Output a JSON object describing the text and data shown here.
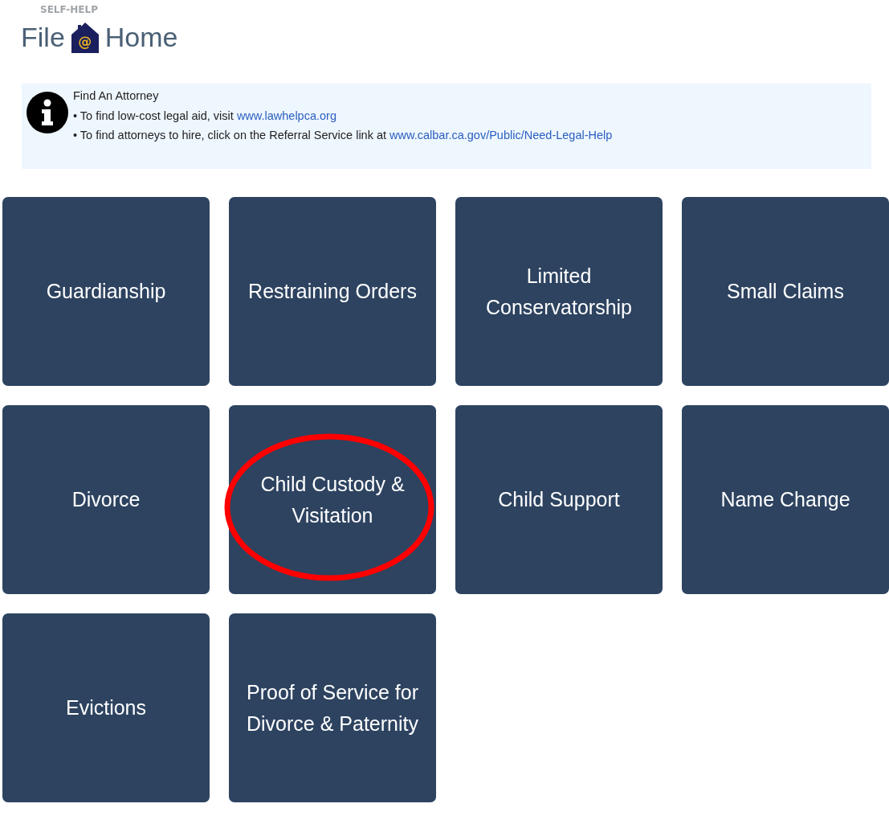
{
  "header": {
    "eyebrow": "SELF-HELP",
    "logo": {
      "left": "File",
      "mark": "@",
      "right": "Home"
    }
  },
  "notice": {
    "title": "Find An Attorney",
    "lines": [
      {
        "text": "• To find low-cost legal aid, visit ",
        "link": "www.lawhelpca.org"
      },
      {
        "text": "• To find attorneys to hire, click on the Referral Service link at ",
        "link": "www.calbar.ca.gov/Public/Need-Legal-Help"
      }
    ]
  },
  "tiles": [
    {
      "label": "Guardianship",
      "circled": false
    },
    {
      "label": "Restraining Orders",
      "circled": false
    },
    {
      "label": "Limited Conservatorship",
      "circled": false
    },
    {
      "label": "Small Claims",
      "circled": false
    },
    {
      "label": "Divorce",
      "circled": false
    },
    {
      "label": "Child Custody & Visitation",
      "circled": true
    },
    {
      "label": "Child Support",
      "circled": false
    },
    {
      "label": "Name Change",
      "circled": false
    },
    {
      "label": "Evictions",
      "circled": false
    },
    {
      "label": "Proof of Service for Divorce & Paternity",
      "circled": false
    }
  ]
}
